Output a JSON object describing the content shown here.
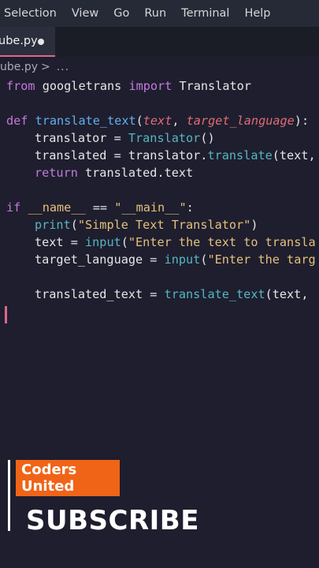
{
  "menu": [
    "Selection",
    "View",
    "Go",
    "Run",
    "Terminal",
    "Help"
  ],
  "tab": {
    "label": "ube.py"
  },
  "breadcrumb": {
    "file": "ube.py",
    "chevron": ">",
    "more": "..."
  },
  "code": {
    "l1": {
      "kw1": "from",
      "t1": " googletrans ",
      "kw2": "import",
      "t2": " Translator"
    },
    "l2": {
      "kw": "def",
      "fn": "translate_text",
      "p1": "(",
      "a1": "text",
      "c": ", ",
      "a2": "target_language",
      "p2": "):"
    },
    "l3": {
      "t1": "translator = ",
      "cls": "Translator",
      "t2": "()"
    },
    "l4": {
      "t1": "translated = translator.",
      "fn": "translate",
      "t2": "(text,"
    },
    "l5": {
      "kw": "return",
      "t1": " translated.text"
    },
    "l6": {
      "kw": "if",
      "dun": "__name__",
      "t1": " == ",
      "str": "\"__main__\"",
      "t2": ":"
    },
    "l7": {
      "fn": "print",
      "p1": "(",
      "str": "\"Simple Text Translator\"",
      "p2": ")"
    },
    "l8": {
      "t1": "text = ",
      "fn": "input",
      "p1": "(",
      "str": "\"Enter the text to transla"
    },
    "l9": {
      "t1": "target_language = ",
      "fn": "input",
      "p1": "(",
      "str": "\"Enter the targ"
    },
    "l10": {
      "t1": "translated_text = ",
      "fn": "translate_text",
      "t2": "(text,"
    }
  },
  "overlay": {
    "badge_line1": "Coders",
    "badge_line2": "United",
    "subscribe": "SUBSCRIBE",
    "badge_color": "#f06418"
  },
  "colors": {
    "keyword": "#c678dd",
    "function": "#61afef",
    "param": "#e06c75",
    "string": "#e5c07b",
    "accent": "#e0658a"
  }
}
